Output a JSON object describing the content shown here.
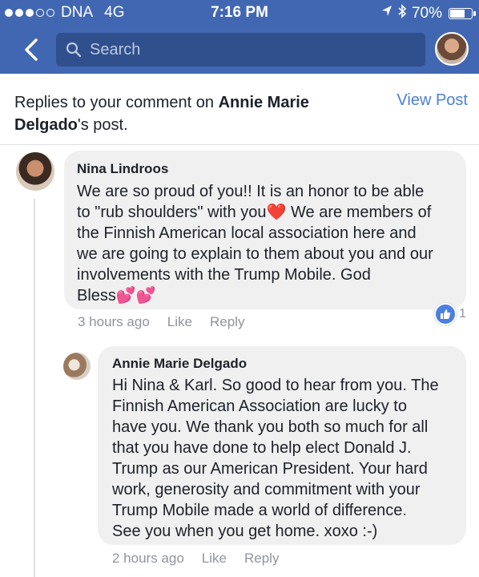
{
  "status_bar": {
    "carrier": "DNA",
    "network": "4G",
    "time": "7:16 PM",
    "battery": "70%",
    "battery_level": 0.7
  },
  "nav": {
    "search_placeholder": "Search"
  },
  "notification": {
    "prefix": "Replies to your comment on ",
    "name": "Annie Marie Delgado",
    "suffix": "'s post.",
    "view_post": "View Post"
  },
  "comments": [
    {
      "author": "Nina Lindroos",
      "body": "We are so proud of you!! It is an  honor to be able\nto \"rub shoulders\" with you❤️ We are members of\nthe Finnish American local association here and\nwe are going to explain to them about you and our\ninvolvements with the Trump Mobile. God\nBless💕💕",
      "time": "3 hours ago",
      "like": "Like",
      "reply": "Reply",
      "reaction_count": "1"
    },
    {
      "author": "Annie Marie Delgado",
      "body": "Hi Nina & Karl. So good to hear from you. The\nFinnish American Association are lucky to\nhave you. We thank you both so much for all\nthat you have done to help elect Donald J.\nTrump as our American President. Your hard\nwork, generosity and commitment with your\nTrump Mobile made a world of difference.\nSee you when you get home. xoxo :-)",
      "time": "2 hours ago",
      "like": "Like",
      "reply": "Reply"
    }
  ],
  "colors": {
    "header_blue": "#4267b2",
    "link_blue": "#4b80d6",
    "bubble_gray": "#f1f0f0",
    "meta_gray": "#90949c"
  }
}
